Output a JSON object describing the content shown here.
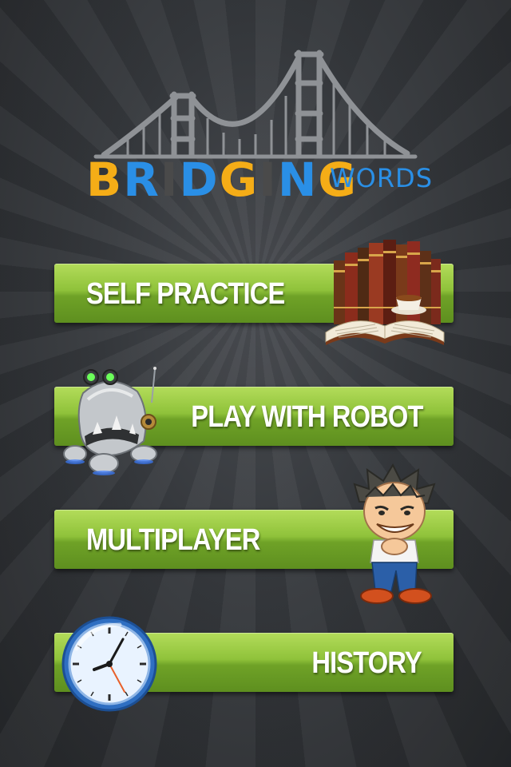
{
  "logo": {
    "title_parts": [
      {
        "text": "B",
        "color": "#f5ad17"
      },
      {
        "text": "R",
        "color": "#2a8fe6"
      },
      {
        "text": "I",
        "color": "#4a4a4a"
      },
      {
        "text": "D",
        "color": "#2a8fe6"
      },
      {
        "text": "G",
        "color": "#f5ad17"
      },
      {
        "text": "I",
        "color": "#4a4a4a"
      },
      {
        "text": "N",
        "color": "#2a8fe6"
      },
      {
        "text": "G",
        "color": "#f5ad17"
      }
    ],
    "subtitle": "WORDS",
    "icon": "golden-gate-bridge-icon"
  },
  "menu": {
    "self_practice": {
      "label": "SELF PRACTICE",
      "icon": "books-teacup-icon"
    },
    "play_with_robot": {
      "label": "PLAY WITH ROBOT",
      "icon": "robot-icon"
    },
    "multiplayer": {
      "label": "MULTIPLAYER",
      "icon": "cartoon-boy-icon"
    },
    "history": {
      "label": "HISTORY",
      "icon": "clock-icon"
    }
  },
  "colors": {
    "button_green": "#8fc23a",
    "background": "#35383c",
    "brand_yellow": "#f5ad17",
    "brand_blue": "#2a8fe6"
  }
}
